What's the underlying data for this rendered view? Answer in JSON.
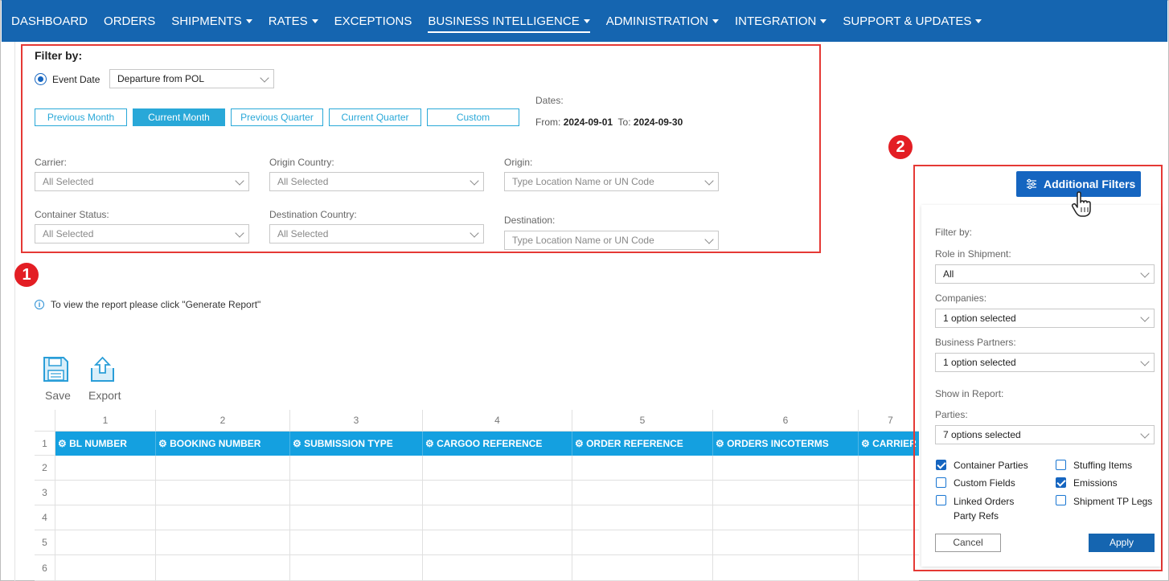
{
  "nav": {
    "items": [
      "DASHBOARD",
      "ORDERS",
      "SHIPMENTS",
      "RATES",
      "EXCEPTIONS",
      "BUSINESS INTELLIGENCE",
      "ADMINISTRATION",
      "INTEGRATION",
      "SUPPORT & UPDATES"
    ]
  },
  "filter": {
    "title": "Filter by:",
    "event_date_label": "Event Date",
    "event_date_value": "Departure from POL",
    "period_buttons": [
      "Previous Month",
      "Current Month",
      "Previous Quarter",
      "Current Quarter",
      "Custom"
    ],
    "dates_label": "Dates:",
    "from_label": "From:",
    "from_value": "2024-09-01",
    "to_label": "To:",
    "to_value": "2024-09-30",
    "carrier_label": "Carrier:",
    "carrier_value": "All Selected",
    "origin_country_label": "Origin Country:",
    "origin_country_value": "All Selected",
    "origin_label": "Origin:",
    "origin_placeholder": "Type Location Name or UN Code",
    "container_status_label": "Container Status:",
    "container_status_value": "All Selected",
    "destination_country_label": "Destination Country:",
    "destination_country_value": "All Selected",
    "destination_label": "Destination:",
    "destination_placeholder": "Type Location Name or UN Code"
  },
  "badges": {
    "one": "1",
    "two": "2"
  },
  "info_text": "To view the report please click \"Generate Report\"",
  "toolbar": {
    "save": "Save",
    "export": "Export"
  },
  "grid": {
    "col_numbers": [
      "1",
      "2",
      "3",
      "4",
      "5",
      "6",
      "7"
    ],
    "row_numbers": [
      "1",
      "2",
      "3",
      "4",
      "5",
      "6"
    ],
    "headers": [
      "BL NUMBER",
      "BOOKING NUMBER",
      "SUBMISSION TYPE",
      "CARGOO REFERENCE",
      "ORDER REFERENCE",
      "ORDERS INCOTERMS",
      "CARRIER"
    ]
  },
  "additional": {
    "button_label": "Additional Filters",
    "filter_by": "Filter by:",
    "role_label": "Role in Shipment:",
    "role_value": "All",
    "companies_label": "Companies:",
    "companies_value": "1 option selected",
    "partners_label": "Business Partners:",
    "partners_value": "1 option selected",
    "show_label": "Show in Report:",
    "parties_label": "Parties:",
    "parties_value": "7 options selected",
    "checkboxes": [
      {
        "label": "Container Parties",
        "checked": true
      },
      {
        "label": "Stuffing Items",
        "checked": false
      },
      {
        "label": "Custom Fields",
        "checked": false
      },
      {
        "label": "Emissions",
        "checked": true
      },
      {
        "label": "Linked Orders",
        "label2": "Party Refs",
        "checked": false
      },
      {
        "label": "Shipment TP Legs",
        "checked": false
      }
    ],
    "cancel": "Cancel",
    "apply": "Apply"
  },
  "colors": {
    "nav": "#1565b0",
    "accent": "#29a8d8",
    "header": "#14a0e0",
    "annotation": "#e31e24"
  }
}
